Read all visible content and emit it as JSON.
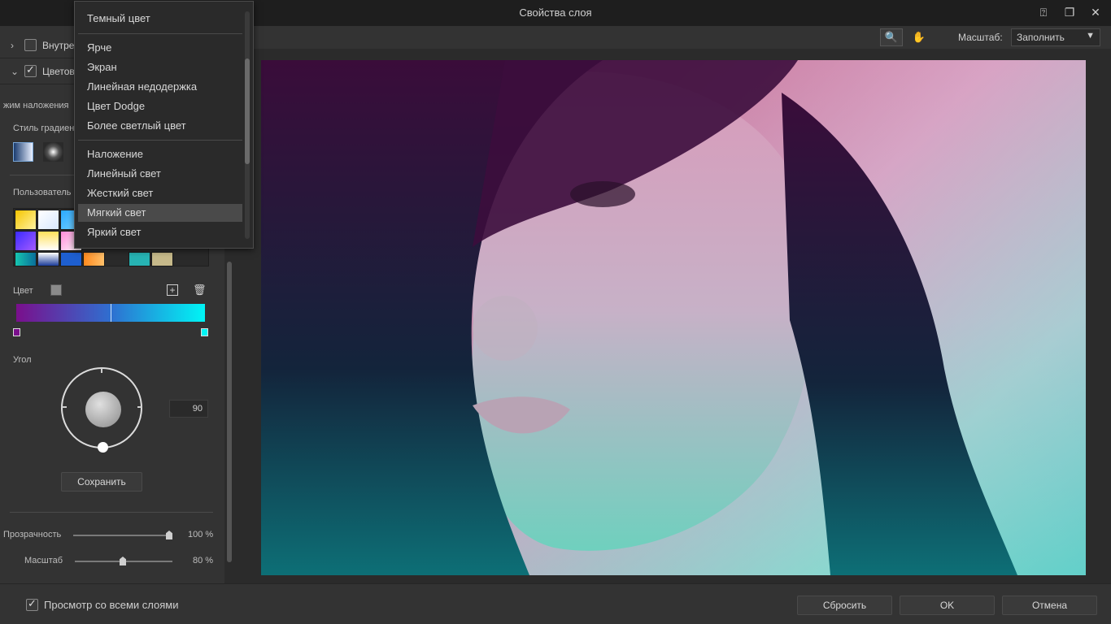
{
  "window": {
    "title": "Свойства слоя"
  },
  "left_panel": {
    "rows": [
      {
        "label": "Внутре",
        "checked": false
      },
      {
        "label": "Цветов",
        "checked": true
      }
    ],
    "blend_mode_label": "жим наложения",
    "gradient_style_label": "Стиль градиен",
    "custom_label": "Пользователь",
    "color_label": "Цвет",
    "angle_label": "Угол",
    "angle_value": "90",
    "save_button": "Сохранить",
    "opacity": {
      "label": "Прозрачность",
      "value_text": "100 %",
      "value": 100
    },
    "scale": {
      "label": "Масштаб",
      "value_text": "80 %",
      "value": 80
    },
    "gradient": {
      "start_color": "#7a0f8c",
      "end_color": "#00f5f5"
    }
  },
  "toolbar": {
    "zoom_label": "Масштаб:",
    "zoom_value": "Заполнить"
  },
  "dropdown": {
    "items": [
      "Темный цвет",
      "Ярче",
      "Экран",
      "Линейная недодержка",
      "Цвет Dodge",
      "Более светлый цвет",
      "Наложение",
      "Линейный свет",
      "Жесткий свет",
      "Мягкий свет",
      "Яркий свет"
    ],
    "selected": "Мягкий свет"
  },
  "bottom_bar": {
    "preview_label": "Просмотр со всеми слоями",
    "preview_checked": true,
    "reset_button": "Сбросить",
    "ok_button": "OK",
    "cancel_button": "Отмена"
  },
  "colors": {
    "accent_start": "#7a0f8c",
    "accent_end": "#00f5f5"
  }
}
